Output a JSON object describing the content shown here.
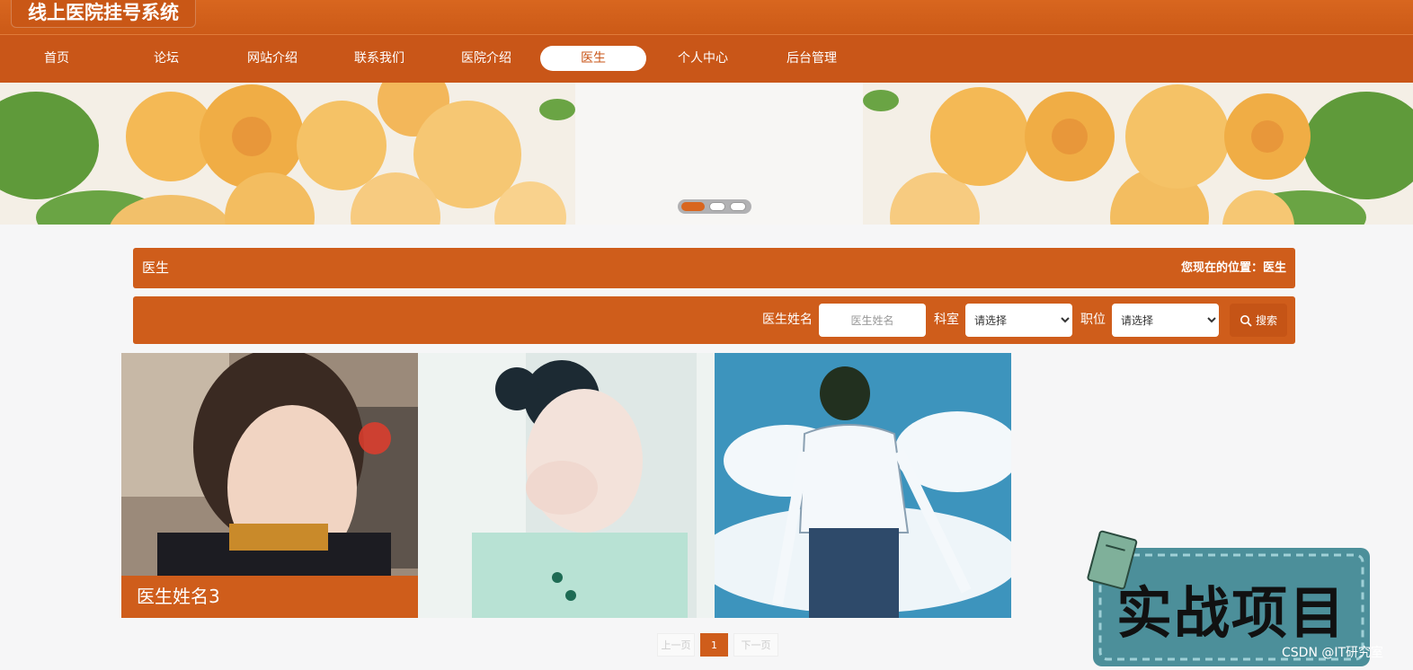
{
  "header": {
    "site_title": "线上医院挂号系统"
  },
  "nav": {
    "items": [
      {
        "label": "首页"
      },
      {
        "label": "论坛"
      },
      {
        "label": "网站介绍"
      },
      {
        "label": "联系我们"
      },
      {
        "label": "医院介绍"
      },
      {
        "label": "医生",
        "active": true
      },
      {
        "label": "个人中心"
      },
      {
        "label": "后台管理"
      }
    ]
  },
  "banner": {
    "slide_count": 3,
    "active_slide": 1
  },
  "section": {
    "title": "医生",
    "location": "您现在的位置：医生"
  },
  "search": {
    "name_label": "医生姓名",
    "name_placeholder": "医生姓名",
    "dept_label": "科室",
    "dept_value": "请选择",
    "title_label": "职位",
    "title_value": "请选择",
    "button_label": "搜索"
  },
  "cards": [
    {
      "caption": "医生姓名3"
    },
    {
      "caption": ""
    },
    {
      "caption": ""
    }
  ],
  "pagination": {
    "prev": "上一页",
    "current": "1",
    "next": "下一页"
  },
  "overlay": {
    "badge_text": "实战项目",
    "watermark": "CSDN @IT研究室"
  },
  "colors": {
    "primary": "#cf5d1b",
    "nav": "#c95618",
    "badge": "#4c8f9a"
  }
}
